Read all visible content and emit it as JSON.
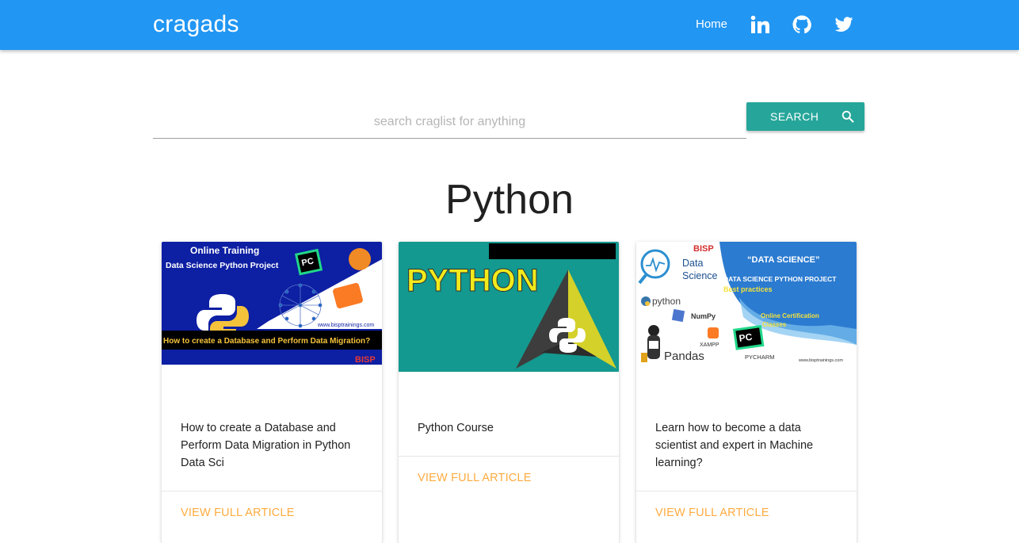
{
  "header": {
    "brand": "cragads",
    "home_label": "Home",
    "icons": [
      "linkedin-icon",
      "github-icon",
      "twitter-icon"
    ]
  },
  "search": {
    "placeholder": "search craglist for anything",
    "value": "",
    "button_label": "SEARCH"
  },
  "page_title": "Python",
  "cards": [
    {
      "image": {
        "title": "Online Training",
        "subtitle": "Data Science Python Project",
        "website": "www.bisptrainings.com",
        "banner": "How to create a Database and Perform Data Migration?",
        "logo": "BISP",
        "badge": "PC"
      },
      "text": "How to create a Database and Perform Data Migration in Python Data Sci",
      "link": "VIEW FULL ARTICLE"
    },
    {
      "image": {
        "title": "PYTHON"
      },
      "text": "Python Course",
      "link": "VIEW FULL ARTICLE"
    },
    {
      "image": {
        "logo": "BISP",
        "data_science": [
          "Data",
          "Science"
        ],
        "quote": "“DATA SCIENCE”",
        "project": "DATA SCIENCE PYTHON PROJECT",
        "best": "Best practices",
        "online": [
          "Online Certification",
          "Classes"
        ],
        "python": "python",
        "numpy": "NumPy",
        "xampp": "XAMPP",
        "pandas": "Pandas",
        "pycharm": "PYCHARM",
        "badge": "PC",
        "website": "www.bisptrainings.com"
      },
      "text": "Learn how to become a data scientist and expert in Machine learning?",
      "link": "VIEW FULL ARTICLE"
    }
  ],
  "colors": {
    "navbar": "#2196f3",
    "search_button": "#26a69a",
    "link": "#ffab40"
  }
}
